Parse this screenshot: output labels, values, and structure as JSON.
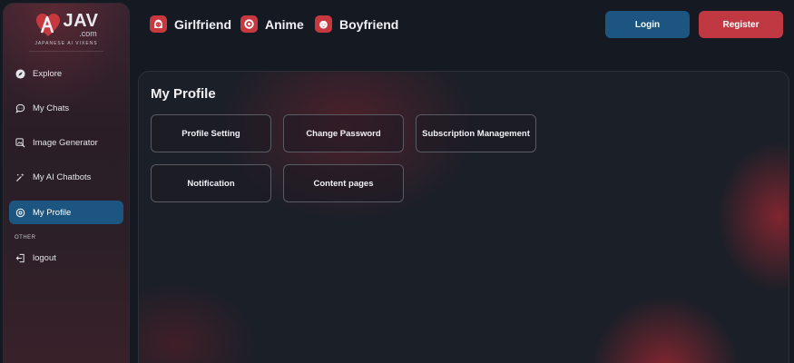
{
  "brand": {
    "title": "JAV",
    "com": ".com",
    "tagline": "JAPANESE AI VIXENS",
    "accent": "#c8383f"
  },
  "sidebar": {
    "items": [
      {
        "label": "Explore",
        "icon": "compass-icon"
      },
      {
        "label": "My Chats",
        "icon": "chat-bubble-icon"
      },
      {
        "label": "Image Generator",
        "icon": "image-generator-icon"
      },
      {
        "label": "My AI Chatbots",
        "icon": "chatbot-wand-icon"
      },
      {
        "label": "My Profile",
        "icon": "profile-settings-icon",
        "active": true
      }
    ],
    "section_other": "OTHER",
    "logout_label": "logout"
  },
  "header": {
    "categories": [
      {
        "label": "Girlfriend",
        "icon": "girl-face-icon"
      },
      {
        "label": "Anime",
        "icon": "anime-icon"
      },
      {
        "label": "Boyfriend",
        "icon": "boy-face-icon"
      }
    ],
    "login_label": "Login",
    "register_label": "Register"
  },
  "main": {
    "title": "My Profile",
    "cards": [
      "Profile Setting",
      "Change Password",
      "Subscription Management",
      "Notification",
      "Content pages"
    ]
  },
  "colors": {
    "active_blue": "#1c5680",
    "register_red": "#bf3842",
    "background": "#141922"
  }
}
